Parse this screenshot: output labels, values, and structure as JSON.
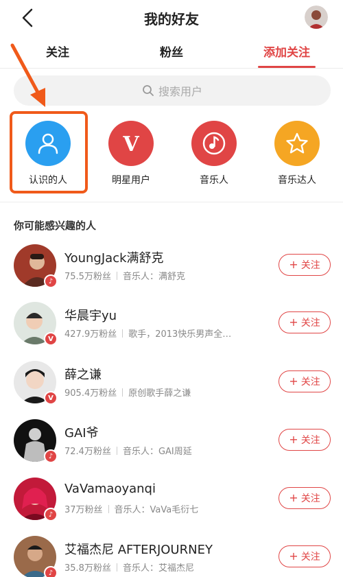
{
  "header": {
    "title": "我的好友"
  },
  "tabs": [
    {
      "label": "关注"
    },
    {
      "label": "粉丝"
    },
    {
      "label": "添加关注"
    }
  ],
  "search": {
    "placeholder": "搜索用户"
  },
  "categories": [
    {
      "label": "认识的人",
      "color": "#2a9ff0",
      "icon": "person-icon"
    },
    {
      "label": "明星用户",
      "color": "#e04545",
      "icon": "v-icon"
    },
    {
      "label": "音乐人",
      "color": "#e04545",
      "icon": "music-note-icon"
    },
    {
      "label": "音乐达人",
      "color": "#f5a623",
      "icon": "star-icon"
    }
  ],
  "suggestions": {
    "title": "你可能感兴趣的人",
    "follow_label": "关注",
    "users": [
      {
        "name": "YoungJack满舒克",
        "fans": "75.5万粉丝",
        "desc": "音乐人：满舒克",
        "badge": "music"
      },
      {
        "name": "华晨宇yu",
        "fans": "427.9万粉丝",
        "desc": "歌手，2013快乐男声全…",
        "badge": "v"
      },
      {
        "name": "薛之谦",
        "fans": "905.4万粉丝",
        "desc": "原创歌手薛之谦",
        "badge": "v"
      },
      {
        "name": "GAI爷",
        "fans": "72.4万粉丝",
        "desc": "音乐人：GAI周延",
        "badge": "music"
      },
      {
        "name": "VaVamaoyanqi",
        "fans": "37万粉丝",
        "desc": "音乐人：VaVa毛衍七",
        "badge": "music"
      },
      {
        "name": "艾福杰尼 AFTERJOURNEY",
        "fans": "35.8万粉丝",
        "desc": "音乐人：艾福杰尼",
        "badge": "music"
      }
    ]
  },
  "colors": {
    "accent": "#e04545",
    "highlight": "#f05a1a"
  }
}
